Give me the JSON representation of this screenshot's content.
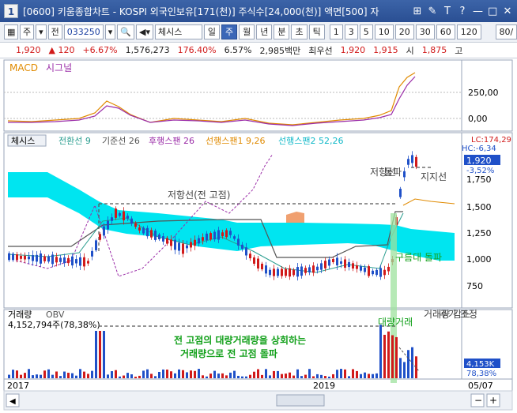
{
  "window": {
    "title": "[0600] 키움종합차트 - KOSPI 외국인보유[171(천)] 주식수[24,000(천)] 액면[500] 자",
    "icon_label": "1"
  },
  "titlebar_buttons": [
    "⊞",
    "✎",
    "T",
    "?",
    "—",
    "□",
    "✕"
  ],
  "toolbar": {
    "market": "주",
    "type": "전",
    "code": "033250",
    "stock_name": "체시스",
    "period_buttons": [
      "일",
      "주",
      "월",
      "년",
      "분",
      "초",
      "틱"
    ],
    "selected_period": "주",
    "interval_buttons": [
      "1",
      "3",
      "5",
      "10",
      "20",
      "30",
      "60",
      "120"
    ],
    "zoom_value": "80/"
  },
  "quote": {
    "price": "1,920",
    "change": "▲ 120",
    "change_pct": "+6.67%",
    "volume": "1,576,273",
    "volume_ratio": "176.40%",
    "turnover": "6.57%",
    "amount": "2,985백만",
    "priority_label": "최우선",
    "ask": "1,920",
    "bid": "1,915",
    "open_label": "시",
    "open": "1,875",
    "high_label": "고"
  },
  "macd": {
    "title": "MACD",
    "signal_label": "시그널",
    "axis_labels": [
      "250,00",
      "0,00"
    ]
  },
  "main": {
    "stock_label": "체시스",
    "legend": [
      {
        "label": "전환선 9",
        "color": "#2a9d8f"
      },
      {
        "label": "기준선 26",
        "color": "#555555"
      },
      {
        "label": "후행스팬 26",
        "color": "#9b2da8"
      },
      {
        "label": "선행스팬1 9,26",
        "color": "#e08a00"
      },
      {
        "label": "선행스팬2 52,26",
        "color": "#10b8c8"
      }
    ],
    "price_axis": [
      "1,750",
      "1,500",
      "1,250",
      "1,000",
      "750"
    ],
    "lc_label": "LC:174,29",
    "hc_label": "HC:-6,34",
    "current_price": "1,920",
    "current_pct": "-3,52%",
    "annotations": {
      "resistance": "저항선(전 고점)",
      "resistance_v": "저항선",
      "breakout_v": "돌파",
      "support": "지지선",
      "cloud_breakout": "구름대 돌파"
    }
  },
  "volume": {
    "title": "거래량",
    "obv_label": "OBV",
    "previous_peak": "4,152,794주(78,38%)",
    "current_volume": "4,153K",
    "current_pct": "78,38%",
    "annotation_line1": "전 고점의 대량거래량을 상회하는",
    "annotation_line2": "거래량으로 전 고점 돌파",
    "annotation_big": "대량거래",
    "annotation_decrease": "거래량 감소",
    "annotation_adjust": "주가 조정"
  },
  "date_axis": [
    "2017",
    "2019",
    "05/07"
  ],
  "colors": {
    "up": "#d11a1a",
    "down": "#1f50c8",
    "cloud": "#00e5f0",
    "cloud_red": "#f0a070",
    "annotation_green": "#12a01a",
    "highlight_band": "#9ee29e"
  },
  "chart_data": {
    "type": "candlestick",
    "x_range": [
      "2017",
      "05/07"
    ],
    "price_range": [
      700,
      1900
    ],
    "latest_close": 1920
  }
}
